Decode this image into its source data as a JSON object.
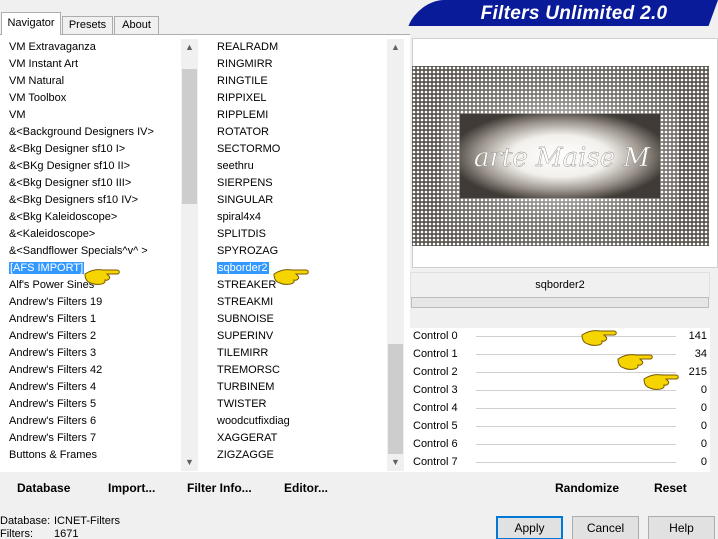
{
  "title": "Filters Unlimited 2.0",
  "tabs": [
    {
      "label": "Navigator",
      "active": true
    },
    {
      "label": "Presets",
      "active": false
    },
    {
      "label": "About",
      "active": false
    }
  ],
  "categories": [
    "VM Extravaganza",
    "VM Instant Art",
    "VM Natural",
    "VM Toolbox",
    "VM",
    "&<Background Designers IV>",
    "&<Bkg Designer sf10 I>",
    "&<BKg Designer sf10 II>",
    "&<Bkg Designer sf10 III>",
    "&<Bkg Designers sf10 IV>",
    "&<Bkg Kaleidoscope>",
    "&<Kaleidoscope>",
    "&<Sandflower Specials^v^ >",
    "[AFS IMPORT]",
    "Alf's Power Sines",
    "Andrew's Filters 19",
    "Andrew's Filters 1",
    "Andrew's Filters 2",
    "Andrew's Filters 3",
    "Andrew's Filters 42",
    "Andrew's Filters 4",
    "Andrew's Filters 5",
    "Andrew's Filters 6",
    "Andrew's Filters 7",
    "Buttons & Frames"
  ],
  "selected_category": "[AFS IMPORT]",
  "filters": [
    "REALRADM",
    "RINGMIRR",
    "RINGTILE",
    "RIPPIXEL",
    "RIPPLEMI",
    "ROTATOR",
    "SECTORMO",
    "seethru",
    "SIERPENS",
    "SINGULAR",
    "spiral4x4",
    "SPLITDIS",
    "SPYROZAG",
    "sqborder2",
    "STREAKER",
    "STREAKMI",
    "SUBNOISE",
    "SUPERINV",
    "TILEMIRR",
    "TREMORSC",
    "TURBINEM",
    "TWISTER",
    "woodcutfixdiag",
    "XAGGERAT",
    "ZIGZAGGE"
  ],
  "selected_filter": "sqborder2",
  "preview": {
    "watermark": "arte Maise M"
  },
  "filter_name": "sqborder2",
  "controls": [
    {
      "label": "Control 0",
      "value": "141"
    },
    {
      "label": "Control 1",
      "value": "34"
    },
    {
      "label": "Control 2",
      "value": "215"
    },
    {
      "label": "Control 3",
      "value": "0"
    },
    {
      "label": "Control 4",
      "value": "0"
    },
    {
      "label": "Control 5",
      "value": "0"
    },
    {
      "label": "Control 6",
      "value": "0"
    },
    {
      "label": "Control 7",
      "value": "0"
    }
  ],
  "toolbar": {
    "database": "Database",
    "import": "Import...",
    "filter_info": "Filter Info...",
    "editor": "Editor...",
    "randomize": "Randomize",
    "reset": "Reset"
  },
  "footer": {
    "database_label": "Database:",
    "database_value": "ICNET-Filters",
    "filters_label": "Filters:",
    "filters_value": "1671"
  },
  "buttons": {
    "apply": "Apply",
    "cancel": "Cancel",
    "help": "Help"
  },
  "colors": {
    "banner": "#0a1b9a",
    "selection": "#3399ff",
    "hand": "#f5d400"
  }
}
